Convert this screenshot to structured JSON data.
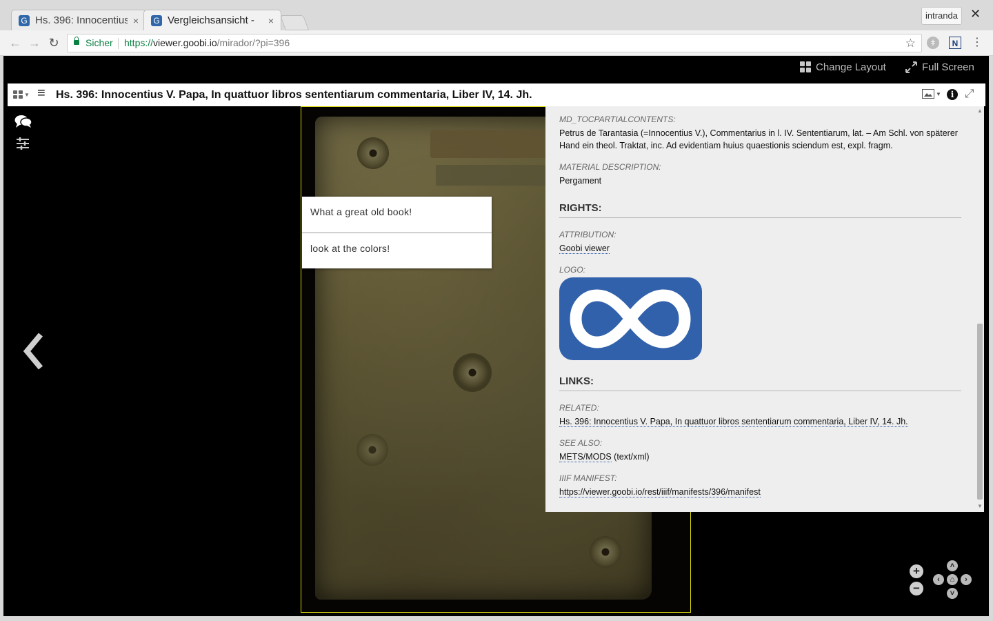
{
  "browser": {
    "tabs": [
      {
        "title": "Hs. 396: Innocentius",
        "active": false,
        "close": "×"
      },
      {
        "title": "Vergleichsansicht -",
        "active": true,
        "close": "×"
      }
    ],
    "profile_name": "intranda",
    "close_window": "✕",
    "back": "←",
    "forward": "→",
    "reload": "↻",
    "secure_label": "Sicher",
    "url_scheme": "https://",
    "url_host": "viewer.goobi.io",
    "url_path": "/mirador/?pi=396",
    "star": "☆",
    "menu": "⋮"
  },
  "mirador": {
    "topbar": {
      "change_layout": "Change Layout",
      "full_screen": "Full Screen"
    },
    "slot": {
      "title": "Hs. 396: Innocentius V. Papa, In quattuor libros sententiarum commentaria, Liber IV, 14. Jh.",
      "menu_glyph": "≡",
      "image_icon_glyph": "▣",
      "info_glyph": "i",
      "expand_glyph": "⤢"
    },
    "sidebar": {
      "comments_glyph": "💬",
      "tools_glyph": "⚌"
    },
    "annotations": [
      {
        "text": "What a great old book!"
      },
      {
        "text": "look at the colors!"
      }
    ]
  },
  "metadata": {
    "toc": {
      "label": "MD_TOCPARTIALCONTENTS:",
      "value": "Petrus de Tarantasia (=Innocentius V.), Commentarius in l. IV. Sententiarum, lat. – Am Schl. von späterer Hand ein theol. Traktat, inc. Ad evidentiam huius quaestionis sciendum est, expl. fragm."
    },
    "material": {
      "label": "MATERIAL DESCRIPTION:",
      "value": "Pergament"
    },
    "rights": {
      "heading": "RIGHTS:",
      "attribution_label": "ATTRIBUTION:",
      "attribution_value": "Goobi viewer",
      "logo_label": "LOGO:"
    },
    "links": {
      "heading": "LINKS:",
      "related_label": "RELATED:",
      "related_value": "Hs. 396: Innocentius V. Papa, In quattuor libros sententiarum commentaria, Liber IV, 14. Jh.",
      "see_also_label": "SEE ALSO:",
      "see_also_link": "METS/MODS",
      "see_also_suffix": " (text/xml)",
      "manifest_label": "IIIF MANIFEST:",
      "manifest_value": "https://viewer.goobi.io/rest/iiif/manifests/396/manifest"
    }
  },
  "icons": {
    "logo": "infinity-logo",
    "prev": "chevron-left-icon",
    "next": "chevron-right-icon"
  },
  "colors": {
    "canvas_border": "#d9d90a",
    "logo_blue": "#3161ab",
    "secure_green": "#0b8043"
  }
}
